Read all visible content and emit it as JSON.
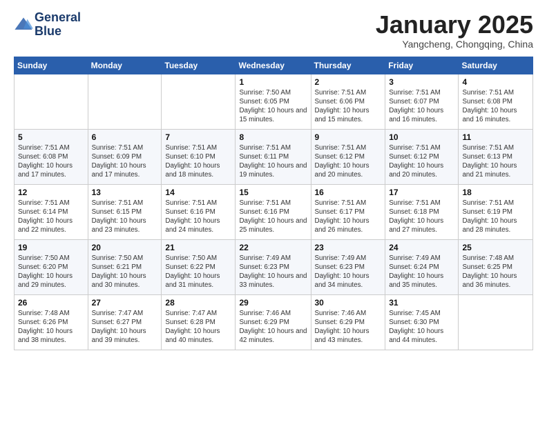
{
  "header": {
    "logo_line1": "General",
    "logo_line2": "Blue",
    "month_title": "January 2025",
    "subtitle": "Yangcheng, Chongqing, China"
  },
  "days_of_week": [
    "Sunday",
    "Monday",
    "Tuesday",
    "Wednesday",
    "Thursday",
    "Friday",
    "Saturday"
  ],
  "weeks": [
    [
      {
        "day": "",
        "info": ""
      },
      {
        "day": "",
        "info": ""
      },
      {
        "day": "",
        "info": ""
      },
      {
        "day": "1",
        "info": "Sunrise: 7:50 AM\nSunset: 6:05 PM\nDaylight: 10 hours and 15 minutes."
      },
      {
        "day": "2",
        "info": "Sunrise: 7:51 AM\nSunset: 6:06 PM\nDaylight: 10 hours and 15 minutes."
      },
      {
        "day": "3",
        "info": "Sunrise: 7:51 AM\nSunset: 6:07 PM\nDaylight: 10 hours and 16 minutes."
      },
      {
        "day": "4",
        "info": "Sunrise: 7:51 AM\nSunset: 6:08 PM\nDaylight: 10 hours and 16 minutes."
      }
    ],
    [
      {
        "day": "5",
        "info": "Sunrise: 7:51 AM\nSunset: 6:08 PM\nDaylight: 10 hours and 17 minutes."
      },
      {
        "day": "6",
        "info": "Sunrise: 7:51 AM\nSunset: 6:09 PM\nDaylight: 10 hours and 17 minutes."
      },
      {
        "day": "7",
        "info": "Sunrise: 7:51 AM\nSunset: 6:10 PM\nDaylight: 10 hours and 18 minutes."
      },
      {
        "day": "8",
        "info": "Sunrise: 7:51 AM\nSunset: 6:11 PM\nDaylight: 10 hours and 19 minutes."
      },
      {
        "day": "9",
        "info": "Sunrise: 7:51 AM\nSunset: 6:12 PM\nDaylight: 10 hours and 20 minutes."
      },
      {
        "day": "10",
        "info": "Sunrise: 7:51 AM\nSunset: 6:12 PM\nDaylight: 10 hours and 20 minutes."
      },
      {
        "day": "11",
        "info": "Sunrise: 7:51 AM\nSunset: 6:13 PM\nDaylight: 10 hours and 21 minutes."
      }
    ],
    [
      {
        "day": "12",
        "info": "Sunrise: 7:51 AM\nSunset: 6:14 PM\nDaylight: 10 hours and 22 minutes."
      },
      {
        "day": "13",
        "info": "Sunrise: 7:51 AM\nSunset: 6:15 PM\nDaylight: 10 hours and 23 minutes."
      },
      {
        "day": "14",
        "info": "Sunrise: 7:51 AM\nSunset: 6:16 PM\nDaylight: 10 hours and 24 minutes."
      },
      {
        "day": "15",
        "info": "Sunrise: 7:51 AM\nSunset: 6:16 PM\nDaylight: 10 hours and 25 minutes."
      },
      {
        "day": "16",
        "info": "Sunrise: 7:51 AM\nSunset: 6:17 PM\nDaylight: 10 hours and 26 minutes."
      },
      {
        "day": "17",
        "info": "Sunrise: 7:51 AM\nSunset: 6:18 PM\nDaylight: 10 hours and 27 minutes."
      },
      {
        "day": "18",
        "info": "Sunrise: 7:51 AM\nSunset: 6:19 PM\nDaylight: 10 hours and 28 minutes."
      }
    ],
    [
      {
        "day": "19",
        "info": "Sunrise: 7:50 AM\nSunset: 6:20 PM\nDaylight: 10 hours and 29 minutes."
      },
      {
        "day": "20",
        "info": "Sunrise: 7:50 AM\nSunset: 6:21 PM\nDaylight: 10 hours and 30 minutes."
      },
      {
        "day": "21",
        "info": "Sunrise: 7:50 AM\nSunset: 6:22 PM\nDaylight: 10 hours and 31 minutes."
      },
      {
        "day": "22",
        "info": "Sunrise: 7:49 AM\nSunset: 6:23 PM\nDaylight: 10 hours and 33 minutes."
      },
      {
        "day": "23",
        "info": "Sunrise: 7:49 AM\nSunset: 6:23 PM\nDaylight: 10 hours and 34 minutes."
      },
      {
        "day": "24",
        "info": "Sunrise: 7:49 AM\nSunset: 6:24 PM\nDaylight: 10 hours and 35 minutes."
      },
      {
        "day": "25",
        "info": "Sunrise: 7:48 AM\nSunset: 6:25 PM\nDaylight: 10 hours and 36 minutes."
      }
    ],
    [
      {
        "day": "26",
        "info": "Sunrise: 7:48 AM\nSunset: 6:26 PM\nDaylight: 10 hours and 38 minutes."
      },
      {
        "day": "27",
        "info": "Sunrise: 7:47 AM\nSunset: 6:27 PM\nDaylight: 10 hours and 39 minutes."
      },
      {
        "day": "28",
        "info": "Sunrise: 7:47 AM\nSunset: 6:28 PM\nDaylight: 10 hours and 40 minutes."
      },
      {
        "day": "29",
        "info": "Sunrise: 7:46 AM\nSunset: 6:29 PM\nDaylight: 10 hours and 42 minutes."
      },
      {
        "day": "30",
        "info": "Sunrise: 7:46 AM\nSunset: 6:29 PM\nDaylight: 10 hours and 43 minutes."
      },
      {
        "day": "31",
        "info": "Sunrise: 7:45 AM\nSunset: 6:30 PM\nDaylight: 10 hours and 44 minutes."
      },
      {
        "day": "",
        "info": ""
      }
    ]
  ]
}
